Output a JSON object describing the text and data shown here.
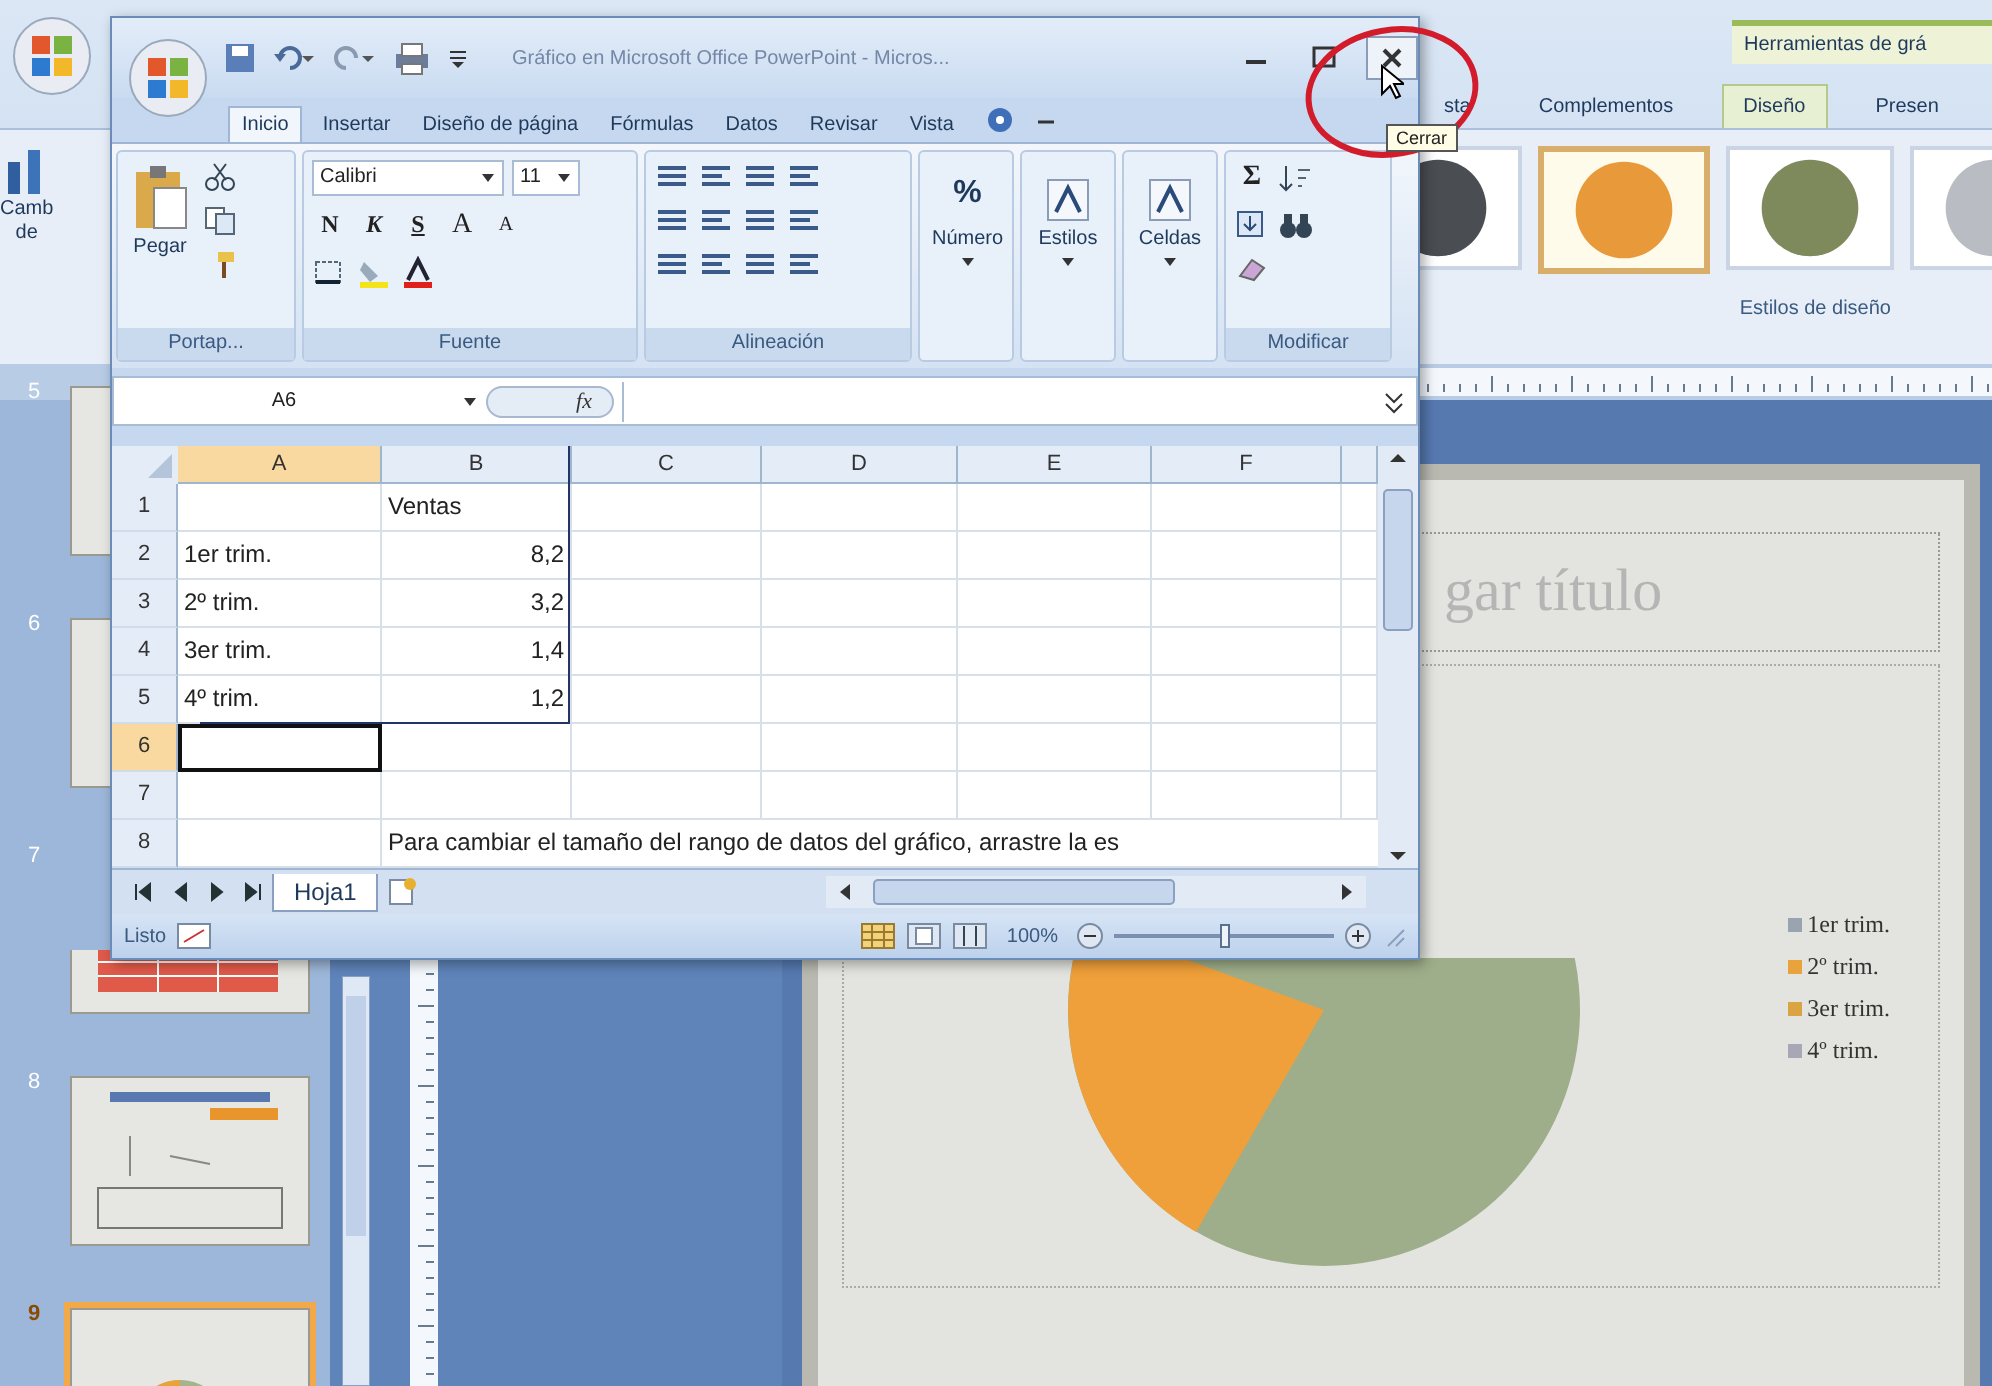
{
  "powerpoint": {
    "contextual_tab_group": "Herramientas de grá",
    "tabs": [
      {
        "label": "sta",
        "selected": false
      },
      {
        "label": "Complementos",
        "selected": false
      },
      {
        "label": "Diseño",
        "selected": true
      },
      {
        "label": "Presen",
        "selected": false
      }
    ],
    "ribbon_button": {
      "label_lines": [
        "Camb",
        "de"
      ]
    },
    "chart_styles": [
      {
        "color": "#4a4d52",
        "selected": false
      },
      {
        "color": "#e89a3a",
        "selected": true
      },
      {
        "color": "#7f8a5c",
        "selected": false
      },
      {
        "color": "#b9bcc2",
        "selected": false
      }
    ],
    "gallery_label": "Estilos de diseño",
    "slides": [
      {
        "number": "5",
        "kind": "blank",
        "selected": false
      },
      {
        "number": "6",
        "kind": "blank",
        "selected": false
      },
      {
        "number": "7",
        "kind": "table",
        "selected": false
      },
      {
        "number": "8",
        "kind": "chart",
        "selected": false
      },
      {
        "number": "9",
        "kind": "pie",
        "selected": true
      }
    ],
    "slide": {
      "title": "gar título",
      "legend": [
        {
          "label": "1er trim.",
          "color": "#9aa3b0"
        },
        {
          "label": "2º trim.",
          "color": "#e8a33c"
        },
        {
          "label": "3er trim.",
          "color": "#d9a441"
        },
        {
          "label": "4º trim.",
          "color": "#a7a7b5"
        }
      ]
    }
  },
  "excel": {
    "title": "Gráfico en Microsoft Office PowerPoint - Micros...",
    "tabs": [
      {
        "label": "Inicio",
        "selected": true
      },
      {
        "label": "Insertar",
        "selected": false
      },
      {
        "label": "Diseño de página",
        "selected": false
      },
      {
        "label": "Fórmulas",
        "selected": false
      },
      {
        "label": "Datos",
        "selected": false
      },
      {
        "label": "Revisar",
        "selected": false
      },
      {
        "label": "Vista",
        "selected": false
      }
    ],
    "ribbon_groups": [
      {
        "kind": "clipboard",
        "label": "Portap...",
        "button": "Pegar"
      },
      {
        "kind": "font",
        "label": "Fuente",
        "font": "Calibri",
        "size": "11",
        "format_buttons": [
          "N",
          "K",
          "S"
        ],
        "size_buttons": [
          "A",
          "A"
        ]
      },
      {
        "kind": "alignment",
        "label": "Alineación"
      },
      {
        "kind": "button",
        "button": "Número",
        "symbol": "%"
      },
      {
        "kind": "button",
        "button": "Estilos"
      },
      {
        "kind": "button",
        "button": "Celdas"
      },
      {
        "kind": "editing",
        "label": "Modificar",
        "symbol": "Σ"
      }
    ],
    "name_box": "A6",
    "formula_button": "fx",
    "columns": [
      {
        "label": "A",
        "selected": true
      },
      {
        "label": "B",
        "selected": false
      },
      {
        "label": "C",
        "selected": false
      },
      {
        "label": "D",
        "selected": false
      },
      {
        "label": "E",
        "selected": false
      },
      {
        "label": "F",
        "selected": false
      }
    ],
    "rows": [
      {
        "number": "1",
        "selected": false,
        "column_b": {
          "kind": "text",
          "text": "Ventas"
        }
      },
      {
        "number": "2",
        "selected": false,
        "column_a": {
          "kind": "text",
          "text": "1er trim."
        },
        "column_b": {
          "kind": "number",
          "text": "8,2"
        }
      },
      {
        "number": "3",
        "selected": false,
        "column_a": {
          "kind": "text",
          "text": "2º trim."
        },
        "column_b": {
          "kind": "number",
          "text": "3,2"
        }
      },
      {
        "number": "4",
        "selected": false,
        "column_a": {
          "kind": "text",
          "text": "3er trim."
        },
        "column_b": {
          "kind": "number",
          "text": "1,4"
        }
      },
      {
        "number": "5",
        "selected": false,
        "column_a": {
          "kind": "text",
          "text": "4º trim."
        },
        "column_b": {
          "kind": "number",
          "text": "1,2"
        }
      },
      {
        "number": "6",
        "selected": true
      },
      {
        "number": "7",
        "selected": false
      },
      {
        "number": "8",
        "selected": false,
        "column_b": {
          "kind": "note",
          "text": "Para cambiar el tamaño del rango de datos del gráfico, arrastre la es"
        }
      }
    ],
    "sheet_tabs": [
      {
        "label": "Hoja1",
        "selected": true
      }
    ],
    "status": "Listo",
    "zoom": {
      "reading": "100%",
      "level": 0.5
    }
  },
  "tooltip": "Cerrar"
}
